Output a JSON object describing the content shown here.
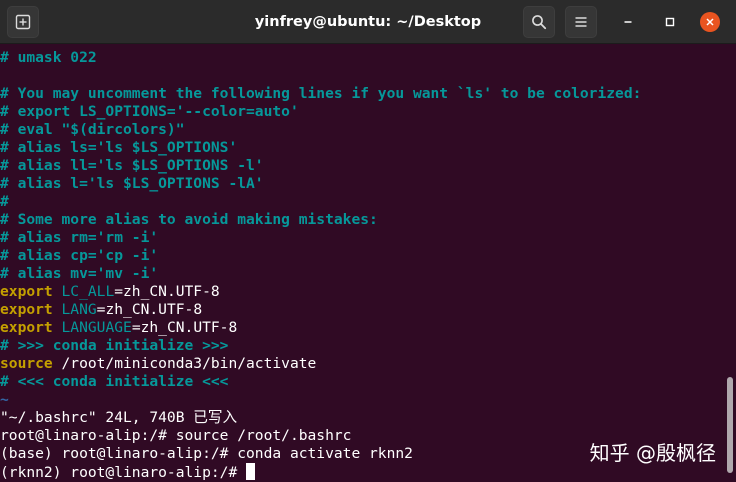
{
  "window": {
    "title": "yinfrey@ubuntu: ~/Desktop",
    "buttons": {
      "new_tab": "new-tab-icon",
      "search": "search-icon",
      "menu": "hamburger-menu-icon",
      "minimize": "minimize-icon",
      "maximize": "maximize-icon",
      "close": "close-icon"
    },
    "colors": {
      "background": "#300a24",
      "titlebar": "#2b2b2b",
      "close_button": "#e95420",
      "comment": "#06989a",
      "keyword": "#c4a000",
      "text": "#ffffff"
    }
  },
  "terminal": {
    "lines": [
      {
        "segments": [
          {
            "t": "# umask 022",
            "s": "c"
          }
        ]
      },
      {
        "segments": []
      },
      {
        "segments": [
          {
            "t": "# You may uncomment the following lines if you want `ls' to be colorized:",
            "s": "c"
          }
        ]
      },
      {
        "segments": [
          {
            "t": "# export LS_OPTIONS='--color=auto'",
            "s": "c"
          }
        ]
      },
      {
        "segments": [
          {
            "t": "# eval \"$(dircolors)\"",
            "s": "c"
          }
        ]
      },
      {
        "segments": [
          {
            "t": "# alias ls='ls $LS_OPTIONS'",
            "s": "c"
          }
        ]
      },
      {
        "segments": [
          {
            "t": "# alias ll='ls $LS_OPTIONS -l'",
            "s": "c"
          }
        ]
      },
      {
        "segments": [
          {
            "t": "# alias l='ls $LS_OPTIONS -lA'",
            "s": "c"
          }
        ]
      },
      {
        "segments": [
          {
            "t": "#",
            "s": "c"
          }
        ]
      },
      {
        "segments": [
          {
            "t": "# Some more alias to avoid making mistakes:",
            "s": "c"
          }
        ]
      },
      {
        "segments": [
          {
            "t": "# alias rm='rm -i'",
            "s": "c"
          }
        ]
      },
      {
        "segments": [
          {
            "t": "# alias cp='cp -i'",
            "s": "c"
          }
        ]
      },
      {
        "segments": [
          {
            "t": "# alias mv='mv -i'",
            "s": "c"
          }
        ]
      },
      {
        "segments": [
          {
            "t": "export",
            "s": "k"
          },
          {
            "t": " ",
            "s": "t"
          },
          {
            "t": "LC_ALL",
            "s": "v"
          },
          {
            "t": "=zh_CN.UTF-8",
            "s": "t"
          }
        ]
      },
      {
        "segments": [
          {
            "t": "export",
            "s": "k"
          },
          {
            "t": " ",
            "s": "t"
          },
          {
            "t": "LANG",
            "s": "v"
          },
          {
            "t": "=zh_CN.UTF-8",
            "s": "t"
          }
        ]
      },
      {
        "segments": [
          {
            "t": "export",
            "s": "k"
          },
          {
            "t": " ",
            "s": "t"
          },
          {
            "t": "LANGUAGE",
            "s": "v"
          },
          {
            "t": "=zh_CN.UTF-8",
            "s": "t"
          }
        ]
      },
      {
        "segments": [
          {
            "t": "# >>> conda initialize >>>",
            "s": "c"
          }
        ]
      },
      {
        "segments": [
          {
            "t": "source",
            "s": "k"
          },
          {
            "t": " /root/miniconda3/bin/activate",
            "s": "t"
          }
        ]
      },
      {
        "segments": [
          {
            "t": "# <<< conda initialize <<<",
            "s": "c"
          }
        ]
      },
      {
        "segments": [
          {
            "t": "~",
            "s": "tl"
          }
        ]
      },
      {
        "segments": [
          {
            "t": "\"~/.bashrc\" 24L, 740B 已写入",
            "s": "t"
          }
        ]
      },
      {
        "segments": [
          {
            "t": "root@linaro-alip:/# source /root/.bashrc",
            "s": "t"
          }
        ]
      },
      {
        "segments": [
          {
            "t": "(base) root@linaro-alip:/# conda activate rknn2",
            "s": "t"
          }
        ]
      },
      {
        "segments": [
          {
            "t": "(rknn2) root@linaro-alip:/# ",
            "s": "t"
          }
        ],
        "cursor": true
      }
    ]
  },
  "watermark": {
    "text": "知乎 @殷枫径"
  }
}
